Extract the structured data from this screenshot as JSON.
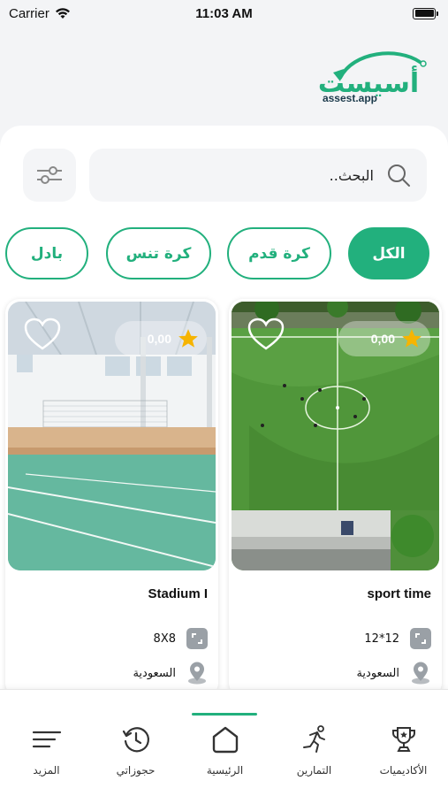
{
  "status_bar": {
    "carrier": "Carrier",
    "time": "11:03 AM"
  },
  "brand": {
    "name": "أسيست",
    "subtitle": "assest.app",
    "color": "#22b07d"
  },
  "search": {
    "placeholder": "..البحث"
  },
  "categories": [
    {
      "label": "الكل",
      "active": true
    },
    {
      "label": "كرة قدم",
      "active": false
    },
    {
      "label": "كرة تنس",
      "active": false
    },
    {
      "label": "بادل",
      "active": false
    }
  ],
  "venues": [
    {
      "name": "sport time",
      "rating": "0,00",
      "size": "12*12",
      "location": "السعودية"
    },
    {
      "name": "Stadium I",
      "rating": "0,00",
      "size": "8X8",
      "location": "السعودية"
    }
  ],
  "bottom_nav": [
    {
      "label": "الأكاديميات",
      "icon": "trophy-icon"
    },
    {
      "label": "التمارين",
      "icon": "running-icon"
    },
    {
      "label": "الرئيسية",
      "icon": "home-icon",
      "active": true
    },
    {
      "label": "حجوزاتي",
      "icon": "history-icon"
    },
    {
      "label": "المزيد",
      "icon": "menu-icon"
    }
  ]
}
